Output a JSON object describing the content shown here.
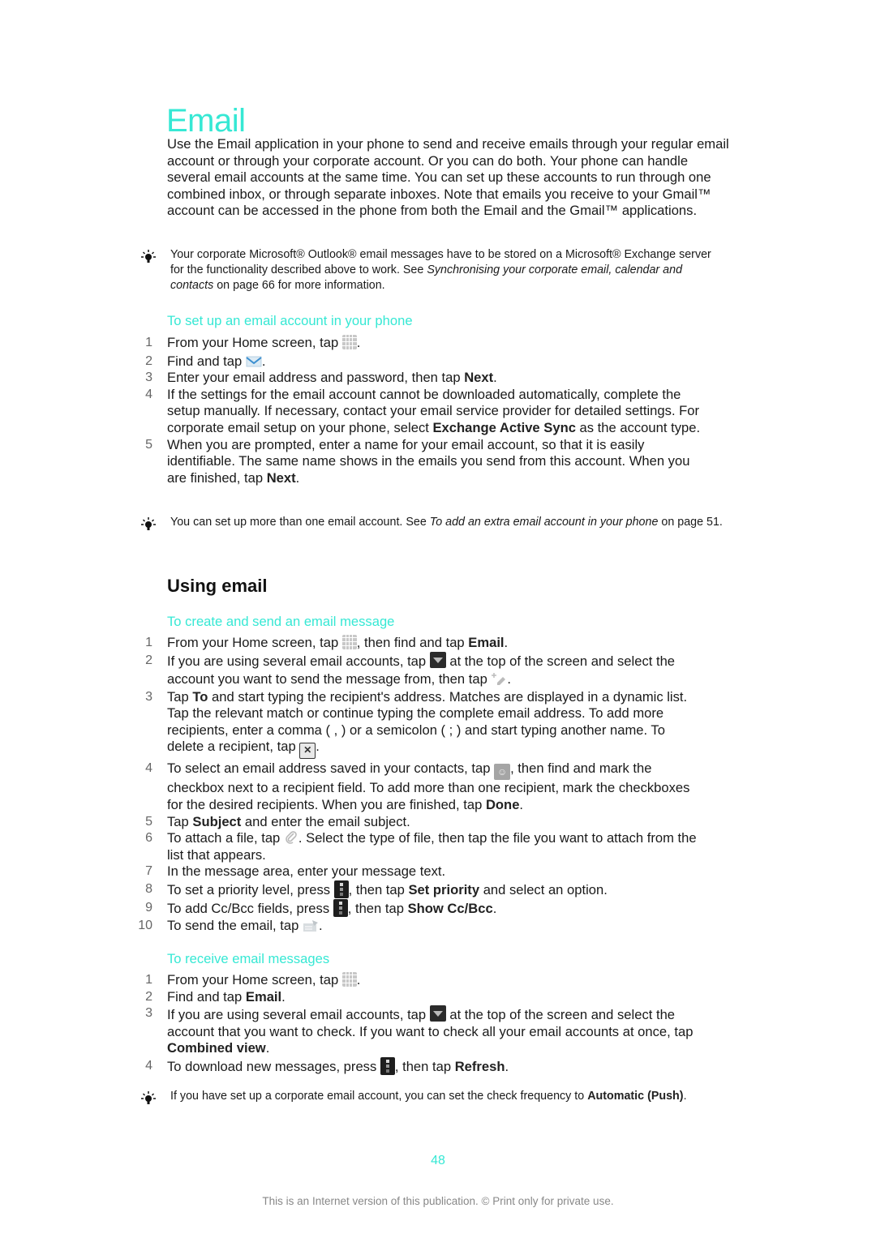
{
  "page": {
    "title": "Email",
    "intro": "Use the Email application in your phone to send and receive emails through your regular email account or through your corporate account. Or you can do both. Your phone can handle several email accounts at the same time. You can set up these accounts to run through one combined inbox, or through separate inboxes. Note that emails you receive to your Gmail™ account can be accessed in the phone from both the Email and the Gmail™ applications."
  },
  "tip1": {
    "icon": "lightbulb-icon",
    "text_a": "Your corporate Microsoft® Outlook® email messages have to be stored on a Microsoft® Exchange server for the functionality described above to work. See ",
    "link": "Synchronising your corporate email, calendar and contacts",
    "text_b": " on page 66 for more information."
  },
  "setup": {
    "heading": "To set up an email account in your phone",
    "steps": [
      {
        "num": "1",
        "a": "From your Home screen, tap ",
        "icon": "application-grid-icon",
        "b": "."
      },
      {
        "num": "2",
        "a": "Find and tap ",
        "icon": "email-envelope-icon",
        "b": "."
      },
      {
        "num": "3",
        "a": "Enter your email address and password, then tap ",
        "bold": "Next",
        "b": "."
      },
      {
        "num": "4",
        "a": "If the settings for the email account cannot be downloaded automatically, complete the setup manually. If necessary, contact your email service provider for detailed settings. For corporate email setup on your phone, select ",
        "bold": "Exchange Active Sync",
        "b": " as the account type."
      },
      {
        "num": "5",
        "a": "When you are prompted, enter a name for your email account, so that it is easily identifiable. The same name shows in the emails you send from this account. When you are finished, tap ",
        "bold": "Next",
        "b": "."
      }
    ]
  },
  "tip2": {
    "icon": "lightbulb-icon",
    "text_a": "You can set up more than one email account. See ",
    "link": "To add an extra email account in your phone",
    "text_b": " on page 51."
  },
  "using": {
    "heading": "Using email",
    "create_heading": "To create and send an email message",
    "create_steps": {
      "s1": {
        "num": "1",
        "a": "From your Home screen, tap ",
        "icon": "application-grid-icon",
        "b": ", then find and tap ",
        "bold": "Email",
        "c": "."
      },
      "s2": {
        "num": "2",
        "a": "If you are using several email accounts, tap ",
        "icon": "dropdown-arrow-icon",
        "b": " at the top of the screen and select the account you want to send the message from, then tap ",
        "icon2": "compose-icon",
        "c": "."
      },
      "s3": {
        "num": "3",
        "a": "Tap ",
        "bold": "To",
        "b": " and start typing the recipient's address. Matches are displayed in a dynamic list. Tap the relevant match or continue typing the complete email address. To add more recipients, enter a comma ( , ) or a semicolon ( ; ) and start typing another name. To delete a recipient, tap ",
        "icon": "delete-recipient-icon",
        "c": "."
      },
      "s4": {
        "num": "4",
        "a": "To select an email address saved in your contacts, tap ",
        "icon": "add-contact-icon",
        "b": ", then find and mark the checkbox next to a recipient field. To add more than one recipient, mark the checkboxes for the desired recipients. When you are finished, tap ",
        "bold": "Done",
        "c": "."
      },
      "s5": {
        "num": "5",
        "a": "Tap ",
        "bold": "Subject",
        "b": " and enter the email subject."
      },
      "s6": {
        "num": "6",
        "a": "To attach a file, tap ",
        "icon": "paperclip-icon",
        "b": ". Select the type of file, then tap the file you want to attach from the list that appears."
      },
      "s7": {
        "num": "7",
        "a": "In the message area, enter your message text."
      },
      "s8": {
        "num": "8",
        "a": "To set a priority level, press ",
        "icon": "menu-key-icon",
        "b": ", then tap ",
        "bold": "Set priority",
        "c": " and select an option."
      },
      "s9": {
        "num": "9",
        "a": "To add Cc/Bcc fields, press ",
        "icon": "menu-key-icon",
        "b": ", then tap ",
        "bold": "Show Cc/Bcc",
        "c": "."
      },
      "s10": {
        "num": "10",
        "a": "To send the email, tap ",
        "icon": "send-icon",
        "b": "."
      }
    },
    "receive_heading": "To receive email messages",
    "receive_steps": {
      "s1": {
        "num": "1",
        "a": "From your Home screen, tap ",
        "icon": "application-grid-icon",
        "b": "."
      },
      "s2": {
        "num": "2",
        "a": "Find and tap ",
        "bold": "Email",
        "b": "."
      },
      "s3": {
        "num": "3",
        "a": "If you are using several email accounts, tap ",
        "icon": "dropdown-arrow-icon",
        "b": " at the top of the screen and select the account that you want to check. If you want to check all your email accounts at once, tap ",
        "bold": "Combined view",
        "c": "."
      },
      "s4": {
        "num": "4",
        "a": "To download new messages, press ",
        "icon": "menu-key-icon",
        "b": ", then tap ",
        "bold": "Refresh",
        "c": "."
      }
    }
  },
  "tip3": {
    "icon": "lightbulb-icon",
    "text_a": "If you have set up a corporate email account, you can set the check frequency to ",
    "bold": "Automatic (Push)",
    "text_b": "."
  },
  "footer": {
    "page_number": "48",
    "note": "This is an Internet version of this publication. © Print only for private use."
  },
  "colors": {
    "accent": "#36e8d4",
    "body_text": "#1a1a1a",
    "footer_text": "#888888"
  }
}
